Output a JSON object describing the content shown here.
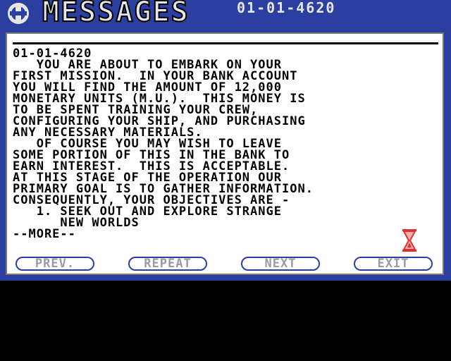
{
  "header": {
    "title": "MESSAGES",
    "date": "01-01-4620"
  },
  "message": {
    "text": "01-01-4620\n   YOU ARE ABOUT TO EMBARK ON YOUR\nFIRST MISSION.  IN YOUR BANK ACCOUNT\nYOU WILL FIND THE AMOUNT OF 12,000\nMONETARY UNITS (M.U.).  THIS MONEY IS\nTO BE SPENT TRAINING YOUR CREW,\nCONFIGURING YOUR SHIP, AND PURCHASING\nANY NECESSARY MATERIALS.\n   OF COURSE YOU MAY WISH TO LEAVE\nSOME PORTION OF THIS IN THE BANK TO\nEARN INTEREST.  THIS IS ACCEPTABLE.\nAT THIS STAGE OF THE OPERATION OUR\nPRIMARY GOAL IS TO GATHER INFORMATION.\nCONSEQUENTLY, YOUR OBJECTIVES ARE -\n   1. SEEK OUT AND EXPLORE STRANGE\n      NEW WORLDS\n--MORE--"
  },
  "buttons": {
    "prev": "PREV.",
    "repeat": "REPEAT",
    "next": "NEXT",
    "exit": "EXIT"
  },
  "colors": {
    "frame": "#2a3f9f",
    "panel": "#ffffff",
    "disabled_text": "#9a9aa6",
    "hourglass": "#e03030"
  }
}
